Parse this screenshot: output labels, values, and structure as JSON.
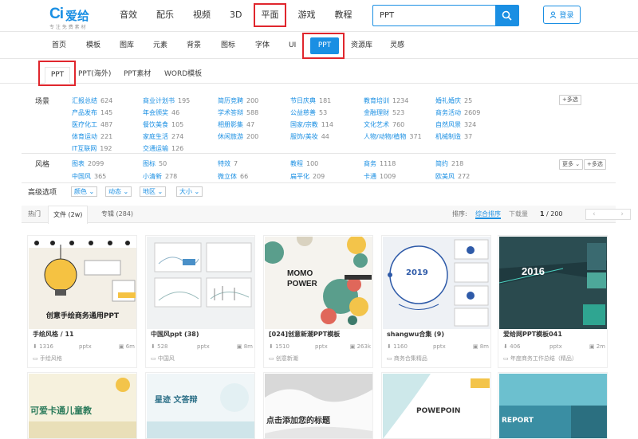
{
  "brand": {
    "mark": "Ci",
    "name": "爱给",
    "slogan": "专 注 免 费 素 材"
  },
  "topnav": [
    "音效",
    "配乐",
    "视频",
    "3D",
    "平面",
    "游戏",
    "教程"
  ],
  "search": {
    "value": "PPT"
  },
  "login": "登录",
  "subnav": [
    "首页",
    "模板",
    "图库",
    "元素",
    "背景",
    "图标",
    "字体",
    "UI",
    "PPT",
    "资源库",
    "灵感"
  ],
  "tabs3": [
    "PPT",
    "PPT(海外)",
    "PPT素材",
    "WORD模板"
  ],
  "filters": {
    "scene_label": "场景",
    "scene": [
      [
        {
          "n": "汇报总结",
          "c": "624"
        },
        {
          "n": "商业计划书",
          "c": "195"
        },
        {
          "n": "简历竞聘",
          "c": "200"
        },
        {
          "n": "节日庆典",
          "c": "181"
        },
        {
          "n": "教育培训",
          "c": "1234"
        },
        {
          "n": "婚礼婚庆",
          "c": "25"
        }
      ],
      [
        {
          "n": "产品发布",
          "c": "145"
        },
        {
          "n": "年会颁奖",
          "c": "46"
        },
        {
          "n": "学术答辩",
          "c": "588"
        },
        {
          "n": "公益慈善",
          "c": "53"
        },
        {
          "n": "金融理财",
          "c": "523"
        },
        {
          "n": "商务活动",
          "c": "2609"
        }
      ],
      [
        {
          "n": "医疗化工",
          "c": "487"
        },
        {
          "n": "餐饮美食",
          "c": "105"
        },
        {
          "n": "相册影集",
          "c": "47"
        },
        {
          "n": "国家/宗教",
          "c": "114"
        },
        {
          "n": "文化艺术",
          "c": "760"
        },
        {
          "n": "自然风景",
          "c": "324"
        }
      ],
      [
        {
          "n": "体育运动",
          "c": "221"
        },
        {
          "n": "家庭生活",
          "c": "274"
        },
        {
          "n": "休闲旅游",
          "c": "200"
        },
        {
          "n": "服饰/美妆",
          "c": "44"
        },
        {
          "n": "人物/动物/植物",
          "c": "371"
        },
        {
          "n": "机械制造",
          "c": "37"
        }
      ],
      [
        {
          "n": "IT互联网",
          "c": "192"
        },
        {
          "n": "交通运输",
          "c": "126"
        }
      ]
    ],
    "scene_more": "+多选",
    "style_label": "风格",
    "style": [
      [
        {
          "n": "图表",
          "c": "2099"
        },
        {
          "n": "图标",
          "c": "50"
        },
        {
          "n": "特效",
          "c": "7"
        },
        {
          "n": "教程",
          "c": "100"
        },
        {
          "n": "商务",
          "c": "1118"
        },
        {
          "n": "简约",
          "c": "218"
        }
      ],
      [
        {
          "n": "中国风",
          "c": "365"
        },
        {
          "n": "小清新",
          "c": "278"
        },
        {
          "n": "微立体",
          "c": "66"
        },
        {
          "n": "扁平化",
          "c": "209"
        },
        {
          "n": "卡通",
          "c": "1009"
        },
        {
          "n": "欧美风",
          "c": "272"
        }
      ]
    ],
    "style_more": "更多",
    "style_multi": "+多选"
  },
  "advanced": {
    "label": "高级选项",
    "selects": [
      "颜色",
      "动态",
      "地区",
      "大小"
    ]
  },
  "sortbar": {
    "tabs": [
      "热门",
      "文件 (2w)",
      "专辑 (284)"
    ],
    "sort_label": "排序:",
    "sort_on": "综合排序",
    "sort_off": "下载量",
    "page": "1",
    "total": "/ 200"
  },
  "cards": [
    {
      "title": "手绘风格 / 11",
      "dl": "1316",
      "fmt": "pptx",
      "size": "6m",
      "tag": "手绘风格",
      "thumb_text": "创意手绘商务通用PPT"
    },
    {
      "title": "中国风ppt (38)",
      "dl": "528",
      "fmt": "pptx",
      "size": "8m",
      "tag": "中国风",
      "thumb_text": ""
    },
    {
      "title": "[024]创意新潮PPT模板",
      "dl": "1510",
      "fmt": "pptx",
      "size": "263k",
      "tag": "创意新潮",
      "thumb_text": "MOMO POWER"
    },
    {
      "title": "shangwu合集 (9)",
      "dl": "1160",
      "fmt": "pptx",
      "size": "8m",
      "tag": "商务合集精品",
      "thumb_text": "2019"
    },
    {
      "title": "爱给网PPT模板041",
      "dl": "406",
      "fmt": "pptx",
      "size": "2m",
      "tag": "年度商务工作总结（精品）",
      "thumb_text": "2016"
    }
  ],
  "cards2": [
    {
      "thumb_text": "可爱卡通儿童教"
    },
    {
      "thumb_text": "星迹 文答辩"
    },
    {
      "thumb_text": "点击添加您的标题"
    },
    {
      "thumb_text": "POWEPOIN"
    },
    {
      "thumb_text": "REPORT"
    }
  ]
}
